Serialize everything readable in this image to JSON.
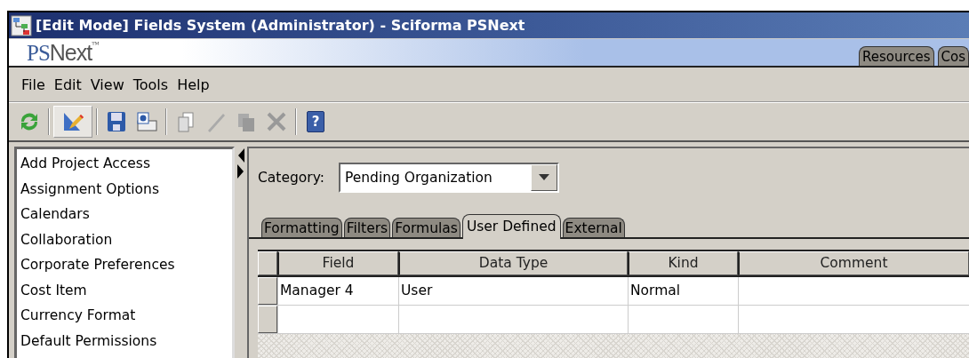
{
  "window": {
    "title": "[Edit Mode] Fields System (Administrator) - Sciforma PSNext"
  },
  "logo": {
    "prefix": "PS",
    "suffix": "Next",
    "mark": "™"
  },
  "module_tabs": [
    {
      "label": "Resources",
      "selected": false
    },
    {
      "label": "Cos",
      "selected": false
    }
  ],
  "menu": [
    "File",
    "Edit",
    "View",
    "Tools",
    "Help"
  ],
  "toolbar": [
    [
      {
        "kind": "refresh",
        "disabled": false,
        "pressed": false
      }
    ],
    [
      {
        "kind": "edit-mode",
        "disabled": false,
        "pressed": true
      }
    ],
    [
      {
        "kind": "save",
        "disabled": false,
        "pressed": false
      },
      {
        "kind": "properties",
        "disabled": false,
        "pressed": false
      }
    ],
    [
      {
        "kind": "copy",
        "disabled": true,
        "pressed": false
      },
      {
        "kind": "pencil",
        "disabled": true,
        "pressed": false
      },
      {
        "kind": "duplicate",
        "disabled": true,
        "pressed": false
      },
      {
        "kind": "delete",
        "disabled": true,
        "pressed": false
      }
    ],
    [
      {
        "kind": "help",
        "disabled": false,
        "pressed": false,
        "glyph": "?"
      }
    ]
  ],
  "sidebar": {
    "items": [
      "Add Project Access",
      "Assignment Options",
      "Calendars",
      "Collaboration",
      "Corporate Preferences",
      "Cost Item",
      "Currency Format",
      "Default Permissions"
    ]
  },
  "category": {
    "label": "Category:",
    "value": "Pending Organization"
  },
  "tabs": [
    {
      "label": "Formatting",
      "selected": false
    },
    {
      "label": "Filters",
      "selected": false
    },
    {
      "label": "Formulas",
      "selected": false
    },
    {
      "label": "User Defined",
      "selected": true
    },
    {
      "label": "External",
      "selected": false
    }
  ],
  "table": {
    "columns": [
      "Field",
      "Data Type",
      "Kind",
      "Comment"
    ],
    "rows": [
      {
        "cells": [
          "Manager 4",
          "User",
          "Normal",
          null
        ]
      },
      {
        "cells": [
          null,
          null,
          null,
          null
        ]
      }
    ]
  }
}
